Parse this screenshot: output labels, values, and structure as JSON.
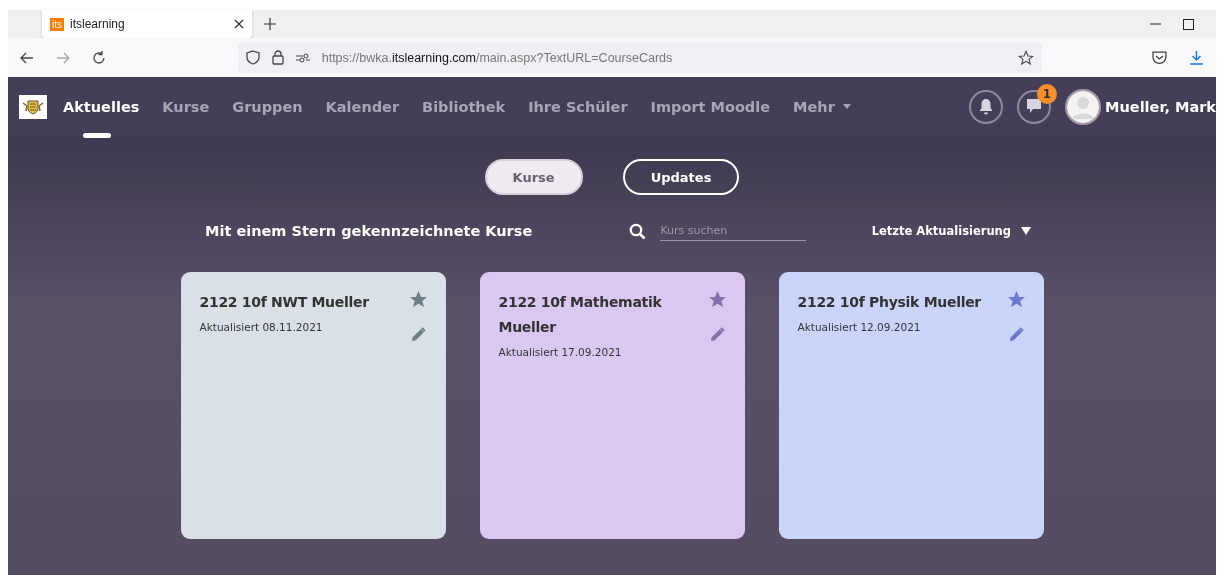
{
  "browser": {
    "tab": {
      "favicon": "its",
      "title": "itslearning"
    },
    "url": {
      "prefix": "https://bwka.",
      "host": "itslearning.com",
      "path": "/main.aspx?TextURL=CourseCards"
    }
  },
  "header": {
    "nav": [
      {
        "label": "Aktuelles",
        "selected": true
      },
      {
        "label": "Kurse",
        "selected": false
      },
      {
        "label": "Gruppen",
        "selected": false
      },
      {
        "label": "Kalender",
        "selected": false
      },
      {
        "label": "Bibliothek",
        "selected": false
      },
      {
        "label": "Ihre Schüler",
        "selected": false
      },
      {
        "label": "Import Moodle",
        "selected": false
      },
      {
        "label": "Mehr",
        "selected": false,
        "dropdown": true
      }
    ],
    "message_badge": "1",
    "user": "Mueller, Mark"
  },
  "view_toggle": [
    {
      "label": "Kurse",
      "selected": true
    },
    {
      "label": "Updates",
      "selected": false
    }
  ],
  "section_title": "Mit einem Stern gekennzeichnete Kurse",
  "search": {
    "placeholder": "Kurs suchen"
  },
  "sort": "Letzte Aktualisierung",
  "cards": [
    {
      "title": "2122 10f NWT Mueller",
      "updated": "Aktualisiert 08.11.2021",
      "color": "#d9e1e6",
      "starred": true
    },
    {
      "title": "2122 10f Mathematik Mueller",
      "updated": "Aktualisiert 17.09.2021",
      "color": "#dbc8f2",
      "starred": true
    },
    {
      "title": "2122 10f Physik Mueller",
      "updated": "Aktualisiert 12.09.2021",
      "color": "#cbd5fc",
      "starred": true
    }
  ]
}
